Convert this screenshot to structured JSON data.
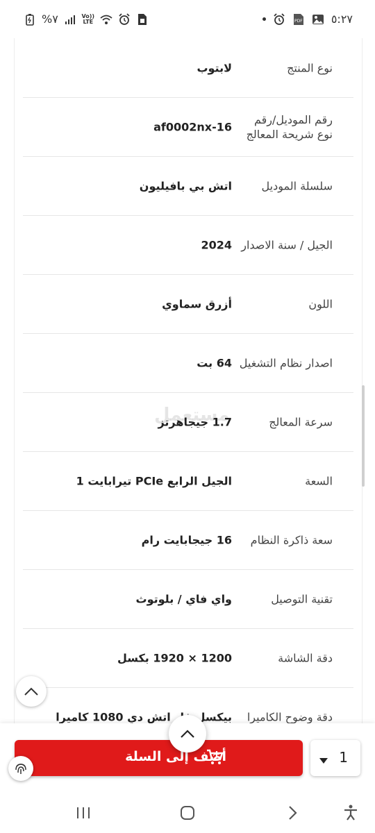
{
  "status_bar": {
    "time": "٥:٢٧",
    "battery": "%٧",
    "network": "LTE",
    "icons_left": [
      "battery-icon",
      "signal-icon",
      "volte-icon",
      "wifi-icon",
      "alarm-icon",
      "sim-icon"
    ],
    "icons_right": [
      "alarm-icon",
      "pdf-icon",
      "gallery-icon",
      "notification-dot"
    ]
  },
  "specs": [
    {
      "label": "نوع المنتج",
      "value": "لابتوب"
    },
    {
      "label": "رقم الموديل/رقم نوع شريحة المعالج",
      "value": "16-af0002nx"
    },
    {
      "label": "سلسلة الموديل",
      "value": "اتش بي بافيليون"
    },
    {
      "label": "الجيل / سنة الاصدار",
      "value": "2024"
    },
    {
      "label": "اللون",
      "value": "أزرق سماوي"
    },
    {
      "label": "اصدار نظام التشغيل",
      "value": "64 بت"
    },
    {
      "label": "سرعة المعالج",
      "value": "1.7 جيجاهرتز"
    },
    {
      "label": "السعة",
      "value": "الجيل الرابع PCIe تيرابايت 1"
    },
    {
      "label": "سعة ذاكرة النظام",
      "value": "16 جيجابايت رام"
    },
    {
      "label": "تقنية التوصيل",
      "value": "واي فاي / بلوتوث"
    },
    {
      "label": "دقة الشاشة",
      "value": "1200 × 1920 بكسل"
    },
    {
      "label": "دقة وضوح الكاميرا",
      "value": "بيكسل فل اتش دي 1080 كاميرا"
    }
  ],
  "watermark": "مستعمل",
  "action_bar": {
    "add_to_cart_label": "أضف إلى السلة",
    "quantity": "1",
    "accent_color": "#e01a1a"
  },
  "nav_bar": {
    "items": [
      "recent-apps-icon",
      "home-icon",
      "back-icon",
      "accessibility-icon"
    ]
  }
}
